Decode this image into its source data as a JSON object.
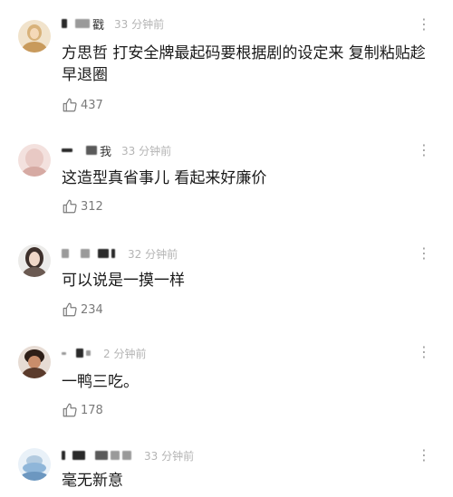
{
  "comments": [
    {
      "name_tail": "戳",
      "time": "33 分钟前",
      "more": "⋮",
      "text": "方思哲 打安全牌最起码要根据剧的设定来 复制粘贴趁早退圈",
      "likes": "437",
      "like_icon": "thumbs-up-icon",
      "avatar_color": "#d8b27a"
    },
    {
      "name_tail": "我",
      "time": "33 分钟前",
      "more": "⋮",
      "text": "这造型真省事儿 看起来好廉价",
      "likes": "312",
      "like_icon": "thumbs-up-icon",
      "avatar_color": "#e8c9c4"
    },
    {
      "name_tail": "",
      "time": "32 分钟前",
      "more": "⋮",
      "text": "可以说是一摸一样",
      "likes": "234",
      "like_icon": "thumbs-up-icon",
      "avatar_color": "#6b5a52"
    },
    {
      "name_tail": "",
      "time": "2 分钟前",
      "more": "⋮",
      "text": "一鸭三吃。",
      "likes": "178",
      "like_icon": "thumbs-up-icon",
      "avatar_color": "#5b3b2c"
    },
    {
      "name_tail": "",
      "time": "33 分钟前",
      "more": "⋮",
      "text": "毫无新意",
      "likes": "",
      "like_icon": "thumbs-up-icon",
      "avatar_color": "#8fb6d9"
    }
  ]
}
